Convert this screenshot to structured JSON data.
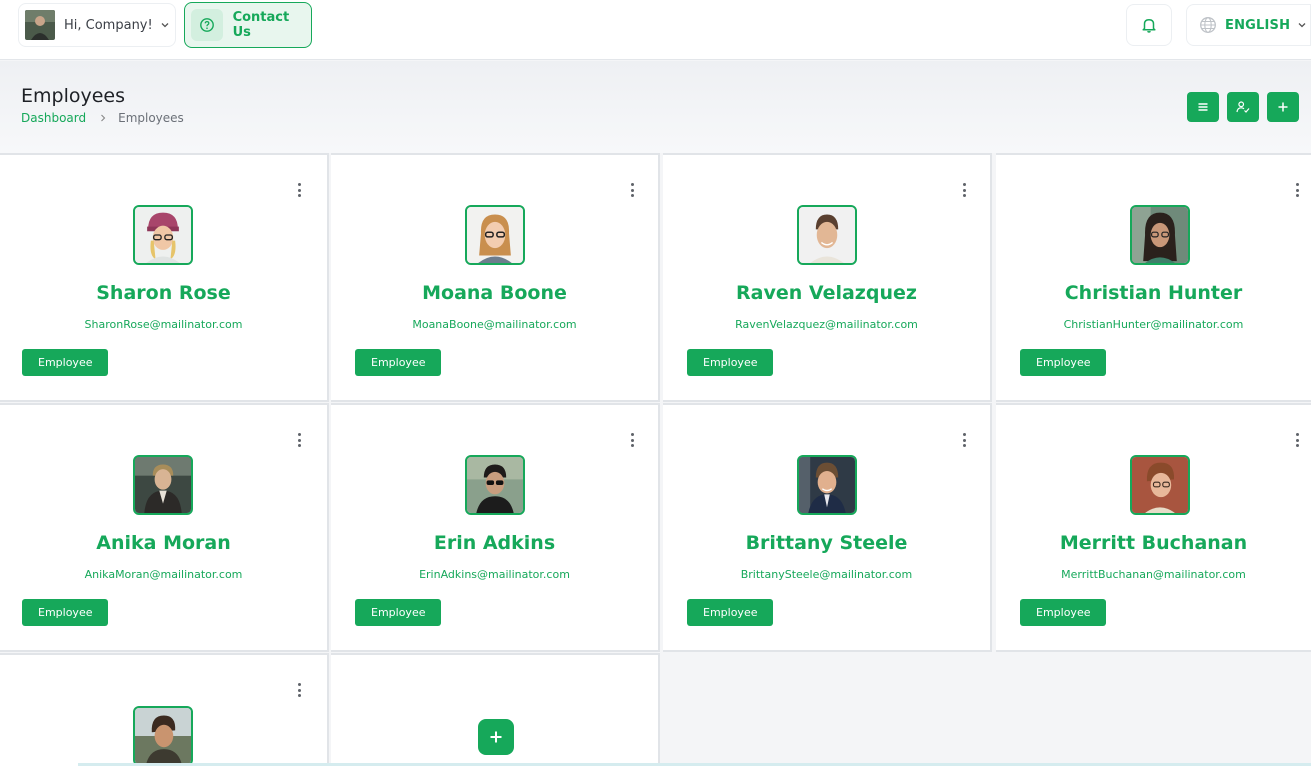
{
  "topbar": {
    "greeting": "Hi, Company!",
    "contact_label": "Contact Us",
    "language_label": "ENGLISH",
    "icons": {
      "user_chevron": "chevron-down-icon",
      "contact": "help-circle-icon",
      "bell": "bell-icon",
      "globe": "globe-icon",
      "lang_chevron": "chevron-down-icon"
    }
  },
  "header": {
    "title": "Employees",
    "breadcrumb_home": "Dashboard",
    "breadcrumb_current": "Employees",
    "actions": [
      "list-view-icon",
      "user-check-icon",
      "plus-icon"
    ]
  },
  "employees": [
    {
      "name": "Sharon Rose",
      "email": "SharonRose@mailinator.com",
      "role": "Employee"
    },
    {
      "name": "Moana Boone",
      "email": "MoanaBoone@mailinator.com",
      "role": "Employee"
    },
    {
      "name": "Raven Velazquez",
      "email": "RavenVelazquez@mailinator.com",
      "role": "Employee"
    },
    {
      "name": "Christian Hunter",
      "email": "ChristianHunter@mailinator.com",
      "role": "Employee"
    },
    {
      "name": "Anika Moran",
      "email": "AnikaMoran@mailinator.com",
      "role": "Employee"
    },
    {
      "name": "Erin Adkins",
      "email": "ErinAdkins@mailinator.com",
      "role": "Employee"
    },
    {
      "name": "Brittany Steele",
      "email": "BrittanySteele@mailinator.com",
      "role": "Employee"
    },
    {
      "name": "Merritt Buchanan",
      "email": "MerrittBuchanan@mailinator.com",
      "role": "Employee"
    }
  ],
  "colors": {
    "accent": "#16a85a",
    "card_border": "#e1e4e8",
    "background": "#f4f5f7"
  }
}
